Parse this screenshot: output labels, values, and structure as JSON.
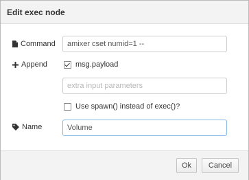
{
  "dialog": {
    "title": "Edit exec node"
  },
  "form": {
    "command": {
      "label": "Command",
      "icon": "file-icon",
      "value": "amixer cset numid=1 --"
    },
    "append": {
      "label": "Append",
      "icon": "plus-icon",
      "checkbox_label": "msg.payload",
      "checked": true,
      "extra_placeholder": "extra input parameters"
    },
    "spawn": {
      "checkbox_label": "Use spawn() instead of exec()?",
      "checked": false
    },
    "name": {
      "label": "Name",
      "icon": "tag-icon",
      "value": "Volume"
    }
  },
  "footer": {
    "ok_label": "Ok",
    "cancel_label": "Cancel"
  }
}
